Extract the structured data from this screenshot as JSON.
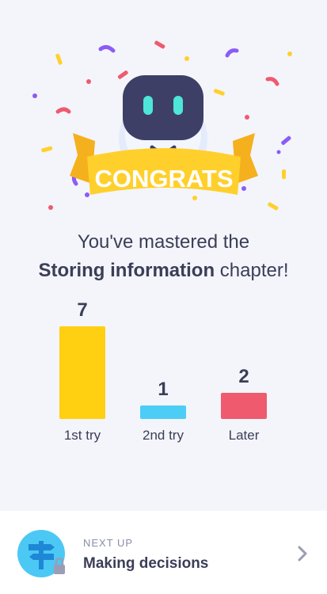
{
  "banner": {
    "text": "CONGRATS"
  },
  "message": {
    "line1": "You've mastered the",
    "chapter": "Storing information",
    "suffix": " chapter!"
  },
  "colors": {
    "first_try": "#ffcf12",
    "second_try": "#4ccdf5",
    "later": "#ef5a6f",
    "banner": "#ffd02c",
    "robot_face": "#3d3f66",
    "robot_eyes": "#4de6d9"
  },
  "chart_data": {
    "type": "bar",
    "categories": [
      "1st try",
      "2nd try",
      "Later"
    ],
    "values": [
      7,
      1,
      2
    ],
    "title": "",
    "xlabel": "",
    "ylabel": "",
    "ylim": [
      0,
      7
    ],
    "grid": false
  },
  "next": {
    "label": "NEXT UP",
    "title": "Making decisions",
    "icon": "signpost-icon",
    "locked": true,
    "lock_icon": "lock-icon",
    "chevron_icon": "chevron-right-icon"
  }
}
